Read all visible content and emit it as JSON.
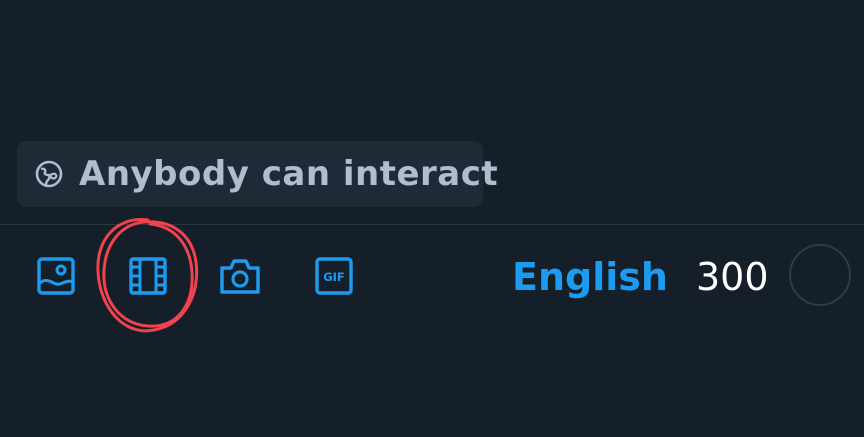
{
  "reply_setting": {
    "label": "Anybody can interact",
    "icon": "globe-icon"
  },
  "toolbar": {
    "tools": [
      {
        "name": "image-icon",
        "label": "Image"
      },
      {
        "name": "video-icon",
        "label": "Video"
      },
      {
        "name": "camera-icon",
        "label": "Camera"
      },
      {
        "name": "gif-icon",
        "label": "GIF"
      }
    ],
    "gif_text": "GIF",
    "language": "English",
    "char_count": "300"
  },
  "colors": {
    "background": "#151f29",
    "accent": "#1d9bf0",
    "annotation": "#f0424f"
  }
}
